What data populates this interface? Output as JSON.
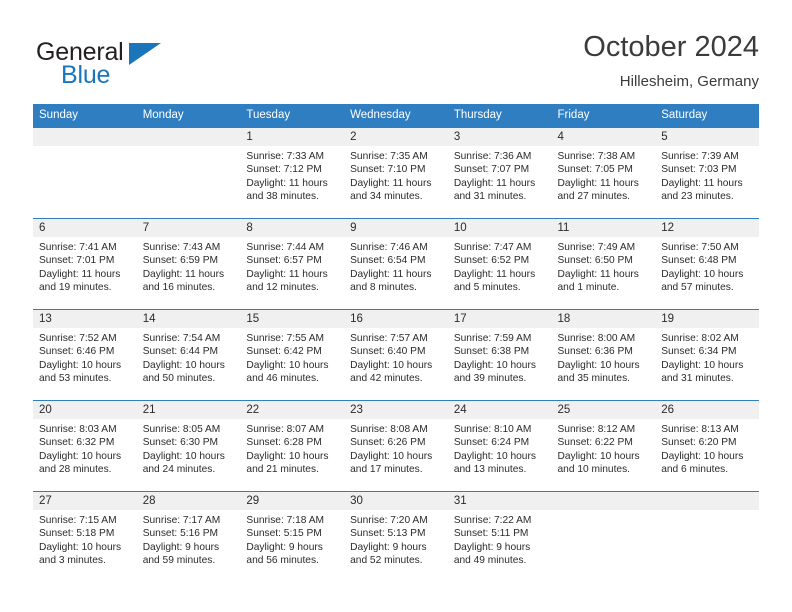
{
  "brand": {
    "name_part1": "General",
    "name_part2": "Blue",
    "logo_icon": "triangle-logo-icon"
  },
  "header": {
    "title": "October 2024",
    "subtitle": "Hillesheim, Germany"
  },
  "colors": {
    "header_blue": "#2f7ec1",
    "brand_blue": "#1b75bb",
    "daynum_band": "#f0f0f0",
    "text": "#2b2b2b"
  },
  "weekday_headers": [
    "Sunday",
    "Monday",
    "Tuesday",
    "Wednesday",
    "Thursday",
    "Friday",
    "Saturday"
  ],
  "labels": {
    "sunrise_prefix": "Sunrise:",
    "sunset_prefix": "Sunset:",
    "daylight_prefix": "Daylight:"
  },
  "weeks": [
    [
      {
        "day": "",
        "sunrise": "",
        "sunset": "",
        "daylight_line1": "",
        "daylight_line2": "",
        "empty": true
      },
      {
        "day": "",
        "sunrise": "",
        "sunset": "",
        "daylight_line1": "",
        "daylight_line2": "",
        "empty": true
      },
      {
        "day": "1",
        "sunrise": "Sunrise: 7:33 AM",
        "sunset": "Sunset: 7:12 PM",
        "daylight_line1": "Daylight: 11 hours",
        "daylight_line2": "and 38 minutes.",
        "empty": false
      },
      {
        "day": "2",
        "sunrise": "Sunrise: 7:35 AM",
        "sunset": "Sunset: 7:10 PM",
        "daylight_line1": "Daylight: 11 hours",
        "daylight_line2": "and 34 minutes.",
        "empty": false
      },
      {
        "day": "3",
        "sunrise": "Sunrise: 7:36 AM",
        "sunset": "Sunset: 7:07 PM",
        "daylight_line1": "Daylight: 11 hours",
        "daylight_line2": "and 31 minutes.",
        "empty": false
      },
      {
        "day": "4",
        "sunrise": "Sunrise: 7:38 AM",
        "sunset": "Sunset: 7:05 PM",
        "daylight_line1": "Daylight: 11 hours",
        "daylight_line2": "and 27 minutes.",
        "empty": false
      },
      {
        "day": "5",
        "sunrise": "Sunrise: 7:39 AM",
        "sunset": "Sunset: 7:03 PM",
        "daylight_line1": "Daylight: 11 hours",
        "daylight_line2": "and 23 minutes.",
        "empty": false
      }
    ],
    [
      {
        "day": "6",
        "sunrise": "Sunrise: 7:41 AM",
        "sunset": "Sunset: 7:01 PM",
        "daylight_line1": "Daylight: 11 hours",
        "daylight_line2": "and 19 minutes.",
        "empty": false
      },
      {
        "day": "7",
        "sunrise": "Sunrise: 7:43 AM",
        "sunset": "Sunset: 6:59 PM",
        "daylight_line1": "Daylight: 11 hours",
        "daylight_line2": "and 16 minutes.",
        "empty": false
      },
      {
        "day": "8",
        "sunrise": "Sunrise: 7:44 AM",
        "sunset": "Sunset: 6:57 PM",
        "daylight_line1": "Daylight: 11 hours",
        "daylight_line2": "and 12 minutes.",
        "empty": false
      },
      {
        "day": "9",
        "sunrise": "Sunrise: 7:46 AM",
        "sunset": "Sunset: 6:54 PM",
        "daylight_line1": "Daylight: 11 hours",
        "daylight_line2": "and 8 minutes.",
        "empty": false
      },
      {
        "day": "10",
        "sunrise": "Sunrise: 7:47 AM",
        "sunset": "Sunset: 6:52 PM",
        "daylight_line1": "Daylight: 11 hours",
        "daylight_line2": "and 5 minutes.",
        "empty": false
      },
      {
        "day": "11",
        "sunrise": "Sunrise: 7:49 AM",
        "sunset": "Sunset: 6:50 PM",
        "daylight_line1": "Daylight: 11 hours",
        "daylight_line2": "and 1 minute.",
        "empty": false
      },
      {
        "day": "12",
        "sunrise": "Sunrise: 7:50 AM",
        "sunset": "Sunset: 6:48 PM",
        "daylight_line1": "Daylight: 10 hours",
        "daylight_line2": "and 57 minutes.",
        "empty": false
      }
    ],
    [
      {
        "day": "13",
        "sunrise": "Sunrise: 7:52 AM",
        "sunset": "Sunset: 6:46 PM",
        "daylight_line1": "Daylight: 10 hours",
        "daylight_line2": "and 53 minutes.",
        "empty": false
      },
      {
        "day": "14",
        "sunrise": "Sunrise: 7:54 AM",
        "sunset": "Sunset: 6:44 PM",
        "daylight_line1": "Daylight: 10 hours",
        "daylight_line2": "and 50 minutes.",
        "empty": false
      },
      {
        "day": "15",
        "sunrise": "Sunrise: 7:55 AM",
        "sunset": "Sunset: 6:42 PM",
        "daylight_line1": "Daylight: 10 hours",
        "daylight_line2": "and 46 minutes.",
        "empty": false
      },
      {
        "day": "16",
        "sunrise": "Sunrise: 7:57 AM",
        "sunset": "Sunset: 6:40 PM",
        "daylight_line1": "Daylight: 10 hours",
        "daylight_line2": "and 42 minutes.",
        "empty": false
      },
      {
        "day": "17",
        "sunrise": "Sunrise: 7:59 AM",
        "sunset": "Sunset: 6:38 PM",
        "daylight_line1": "Daylight: 10 hours",
        "daylight_line2": "and 39 minutes.",
        "empty": false
      },
      {
        "day": "18",
        "sunrise": "Sunrise: 8:00 AM",
        "sunset": "Sunset: 6:36 PM",
        "daylight_line1": "Daylight: 10 hours",
        "daylight_line2": "and 35 minutes.",
        "empty": false
      },
      {
        "day": "19",
        "sunrise": "Sunrise: 8:02 AM",
        "sunset": "Sunset: 6:34 PM",
        "daylight_line1": "Daylight: 10 hours",
        "daylight_line2": "and 31 minutes.",
        "empty": false
      }
    ],
    [
      {
        "day": "20",
        "sunrise": "Sunrise: 8:03 AM",
        "sunset": "Sunset: 6:32 PM",
        "daylight_line1": "Daylight: 10 hours",
        "daylight_line2": "and 28 minutes.",
        "empty": false
      },
      {
        "day": "21",
        "sunrise": "Sunrise: 8:05 AM",
        "sunset": "Sunset: 6:30 PM",
        "daylight_line1": "Daylight: 10 hours",
        "daylight_line2": "and 24 minutes.",
        "empty": false
      },
      {
        "day": "22",
        "sunrise": "Sunrise: 8:07 AM",
        "sunset": "Sunset: 6:28 PM",
        "daylight_line1": "Daylight: 10 hours",
        "daylight_line2": "and 21 minutes.",
        "empty": false
      },
      {
        "day": "23",
        "sunrise": "Sunrise: 8:08 AM",
        "sunset": "Sunset: 6:26 PM",
        "daylight_line1": "Daylight: 10 hours",
        "daylight_line2": "and 17 minutes.",
        "empty": false
      },
      {
        "day": "24",
        "sunrise": "Sunrise: 8:10 AM",
        "sunset": "Sunset: 6:24 PM",
        "daylight_line1": "Daylight: 10 hours",
        "daylight_line2": "and 13 minutes.",
        "empty": false
      },
      {
        "day": "25",
        "sunrise": "Sunrise: 8:12 AM",
        "sunset": "Sunset: 6:22 PM",
        "daylight_line1": "Daylight: 10 hours",
        "daylight_line2": "and 10 minutes.",
        "empty": false
      },
      {
        "day": "26",
        "sunrise": "Sunrise: 8:13 AM",
        "sunset": "Sunset: 6:20 PM",
        "daylight_line1": "Daylight: 10 hours",
        "daylight_line2": "and 6 minutes.",
        "empty": false
      }
    ],
    [
      {
        "day": "27",
        "sunrise": "Sunrise: 7:15 AM",
        "sunset": "Sunset: 5:18 PM",
        "daylight_line1": "Daylight: 10 hours",
        "daylight_line2": "and 3 minutes.",
        "empty": false
      },
      {
        "day": "28",
        "sunrise": "Sunrise: 7:17 AM",
        "sunset": "Sunset: 5:16 PM",
        "daylight_line1": "Daylight: 9 hours",
        "daylight_line2": "and 59 minutes.",
        "empty": false
      },
      {
        "day": "29",
        "sunrise": "Sunrise: 7:18 AM",
        "sunset": "Sunset: 5:15 PM",
        "daylight_line1": "Daylight: 9 hours",
        "daylight_line2": "and 56 minutes.",
        "empty": false
      },
      {
        "day": "30",
        "sunrise": "Sunrise: 7:20 AM",
        "sunset": "Sunset: 5:13 PM",
        "daylight_line1": "Daylight: 9 hours",
        "daylight_line2": "and 52 minutes.",
        "empty": false
      },
      {
        "day": "31",
        "sunrise": "Sunrise: 7:22 AM",
        "sunset": "Sunset: 5:11 PM",
        "daylight_line1": "Daylight: 9 hours",
        "daylight_line2": "and 49 minutes.",
        "empty": false
      },
      {
        "day": "",
        "sunrise": "",
        "sunset": "",
        "daylight_line1": "",
        "daylight_line2": "",
        "empty": true
      },
      {
        "day": "",
        "sunrise": "",
        "sunset": "",
        "daylight_line1": "",
        "daylight_line2": "",
        "empty": true
      }
    ]
  ]
}
